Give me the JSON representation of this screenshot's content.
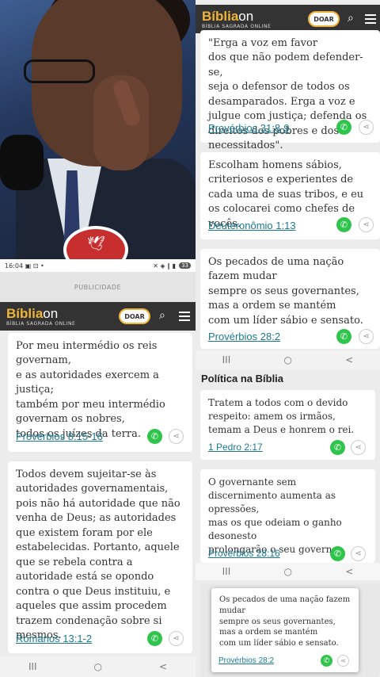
{
  "video": {
    "status_time": "16:04",
    "status_icons_left": "▣ ⊡ •",
    "status_icons_right": "✕ ◈ ∥ ▮",
    "battery": "33"
  },
  "publicidade": "PUBLICIDADE",
  "brand": {
    "name_a": "Bíblia",
    "name_b": "on",
    "tagline": "BÍBLIA SAGRADA ONLINE",
    "donate": "DOAR"
  },
  "left_cards": [
    {
      "text": "Por meu intermédio os reis governam,\ne as autoridades exercem a justiça;\ntambém por meu intermédio governam os nobres,\ntodos os juízes da terra.",
      "ref": "Provérbios 8:15-16"
    },
    {
      "text": "Todos devem sujeitar-se às autoridades governamentais, pois não há autoridade que não venha de Deus; as autoridades que existem foram por ele estabelecidas. Portanto, aquele que se rebela contra a autoridade está se opondo contra o que Deus instituiu, e aqueles que assim procedem trazem condenação sobre si mesmos.",
      "ref": "Romanos 13:1-2"
    }
  ],
  "right_top_cards": [
    {
      "text": "\"Erga a voz em favor\ndos que não podem defender-se,\nseja o defensor de todos os desamparados. Erga a voz e julgue com justiça; defenda os direitos dos pobres e dos necessitados\".",
      "ref": "Provérbios 31:8-9"
    },
    {
      "text": "Escolham homens sábios, criteriosos e experientes de cada uma de suas tribos, e eu os colocarei como chefes de vocês.",
      "ref": "Deuteronômio 1:13"
    },
    {
      "text": "Os pecados de uma nação fazem mudar\nsempre os seus governantes,\nmas a ordem se mantém\ncom um líder sábio e sensato.",
      "ref": "Provérbios 28:2"
    }
  ],
  "section_title": "Política na Bíblia",
  "right_mid_cards": [
    {
      "text": "Tratem a todos com o devido respeito: amem os irmãos, temam a Deus e honrem o rei.",
      "ref": "1 Pedro 2:17"
    },
    {
      "text": "O governante sem discernimento aumenta as opressões,\nmas os que odeiam o ganho desonesto\nprolongarão o seu governo.",
      "ref": "Provérbios 28:16"
    }
  ],
  "popup_card": {
    "text": "Os pecados de uma nação fazem mudar\nsempre os seus governantes,\nmas a ordem se mantém\ncom um líder sábio e sensato.",
    "ref": "Provérbios 28:2"
  },
  "nav": {
    "recent": "III",
    "home": "○",
    "back": "<"
  },
  "icons": {
    "search": "search-icon",
    "menu": "menu-icon",
    "whatsapp": "whatsapp-icon",
    "share": "share-icon"
  },
  "colors": {
    "header": "#333333",
    "accent": "#f0b43a",
    "link": "#1a7a92",
    "whatsapp": "#2fc44b"
  }
}
